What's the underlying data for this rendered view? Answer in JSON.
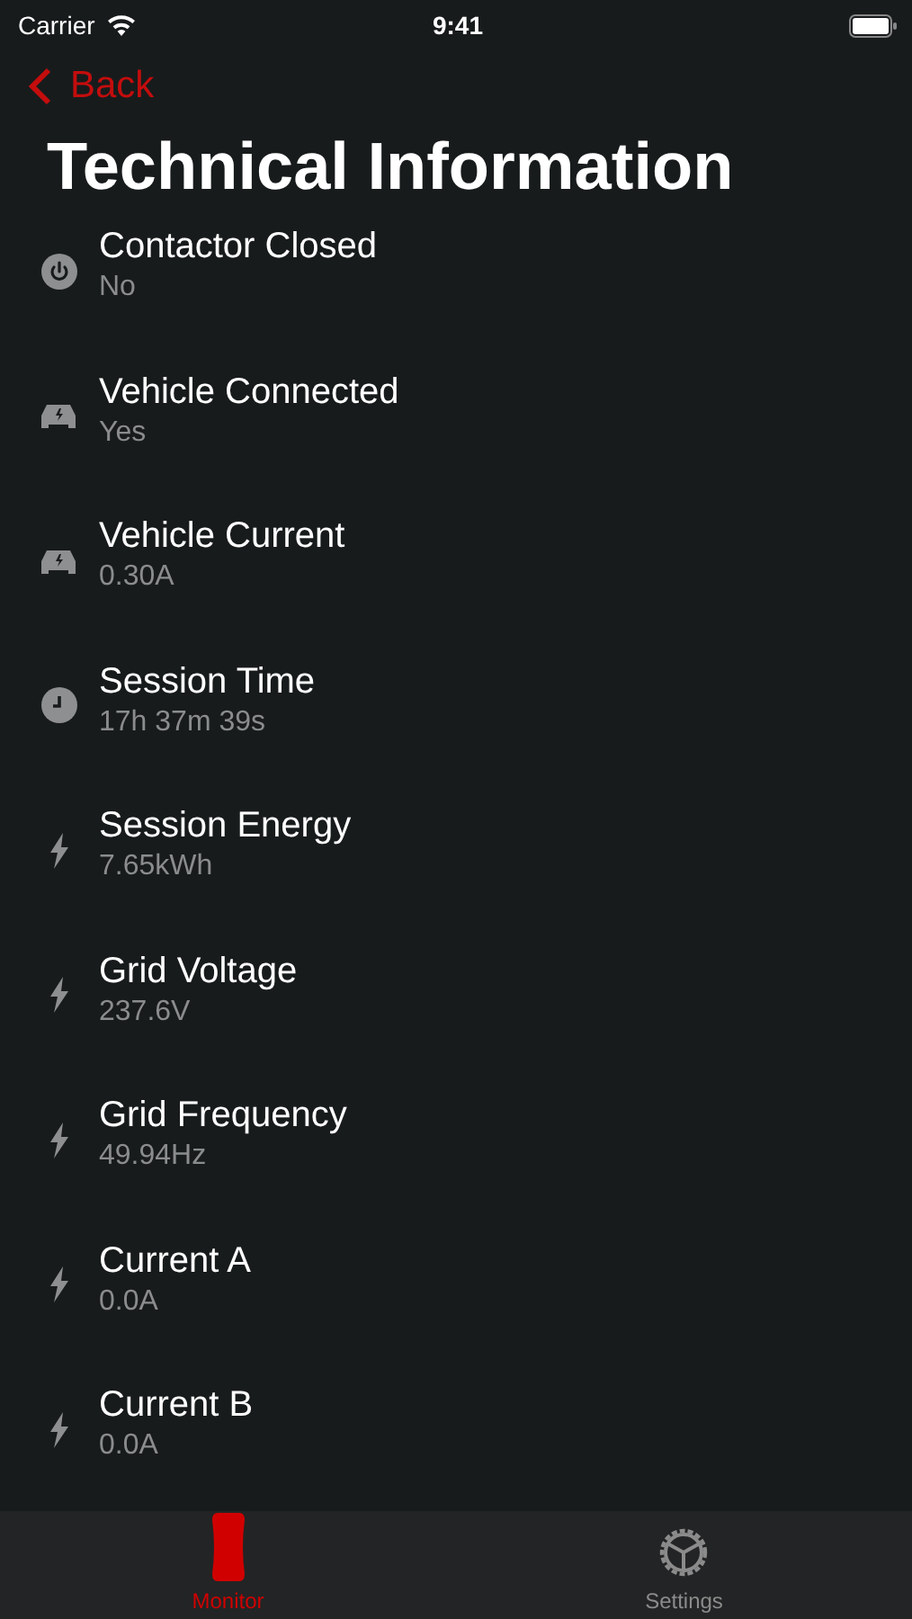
{
  "status_bar": {
    "carrier": "Carrier",
    "time": "9:41"
  },
  "nav": {
    "back_label": "Back"
  },
  "title": "Technical Information",
  "items": [
    {
      "kind": "power",
      "label": "Contactor Closed",
      "value": "No"
    },
    {
      "kind": "vehicle",
      "label": "Vehicle Connected",
      "value": "Yes"
    },
    {
      "kind": "vehicle",
      "label": "Vehicle Current",
      "value": "0.30A"
    },
    {
      "kind": "clock",
      "label": "Session Time",
      "value": "17h 37m 39s"
    },
    {
      "kind": "bolt",
      "label": "Session Energy",
      "value": "7.65kWh"
    },
    {
      "kind": "bolt",
      "label": "Grid Voltage",
      "value": "237.6V"
    },
    {
      "kind": "bolt",
      "label": "Grid Frequency",
      "value": "49.94Hz"
    },
    {
      "kind": "bolt",
      "label": "Current A",
      "value": "0.0A"
    },
    {
      "kind": "bolt",
      "label": "Current B",
      "value": "0.0A"
    }
  ],
  "tab_bar": [
    {
      "kind": "monitor",
      "label": "Monitor",
      "selected": true
    },
    {
      "kind": "settings",
      "label": "Settings",
      "selected": false
    }
  ]
}
